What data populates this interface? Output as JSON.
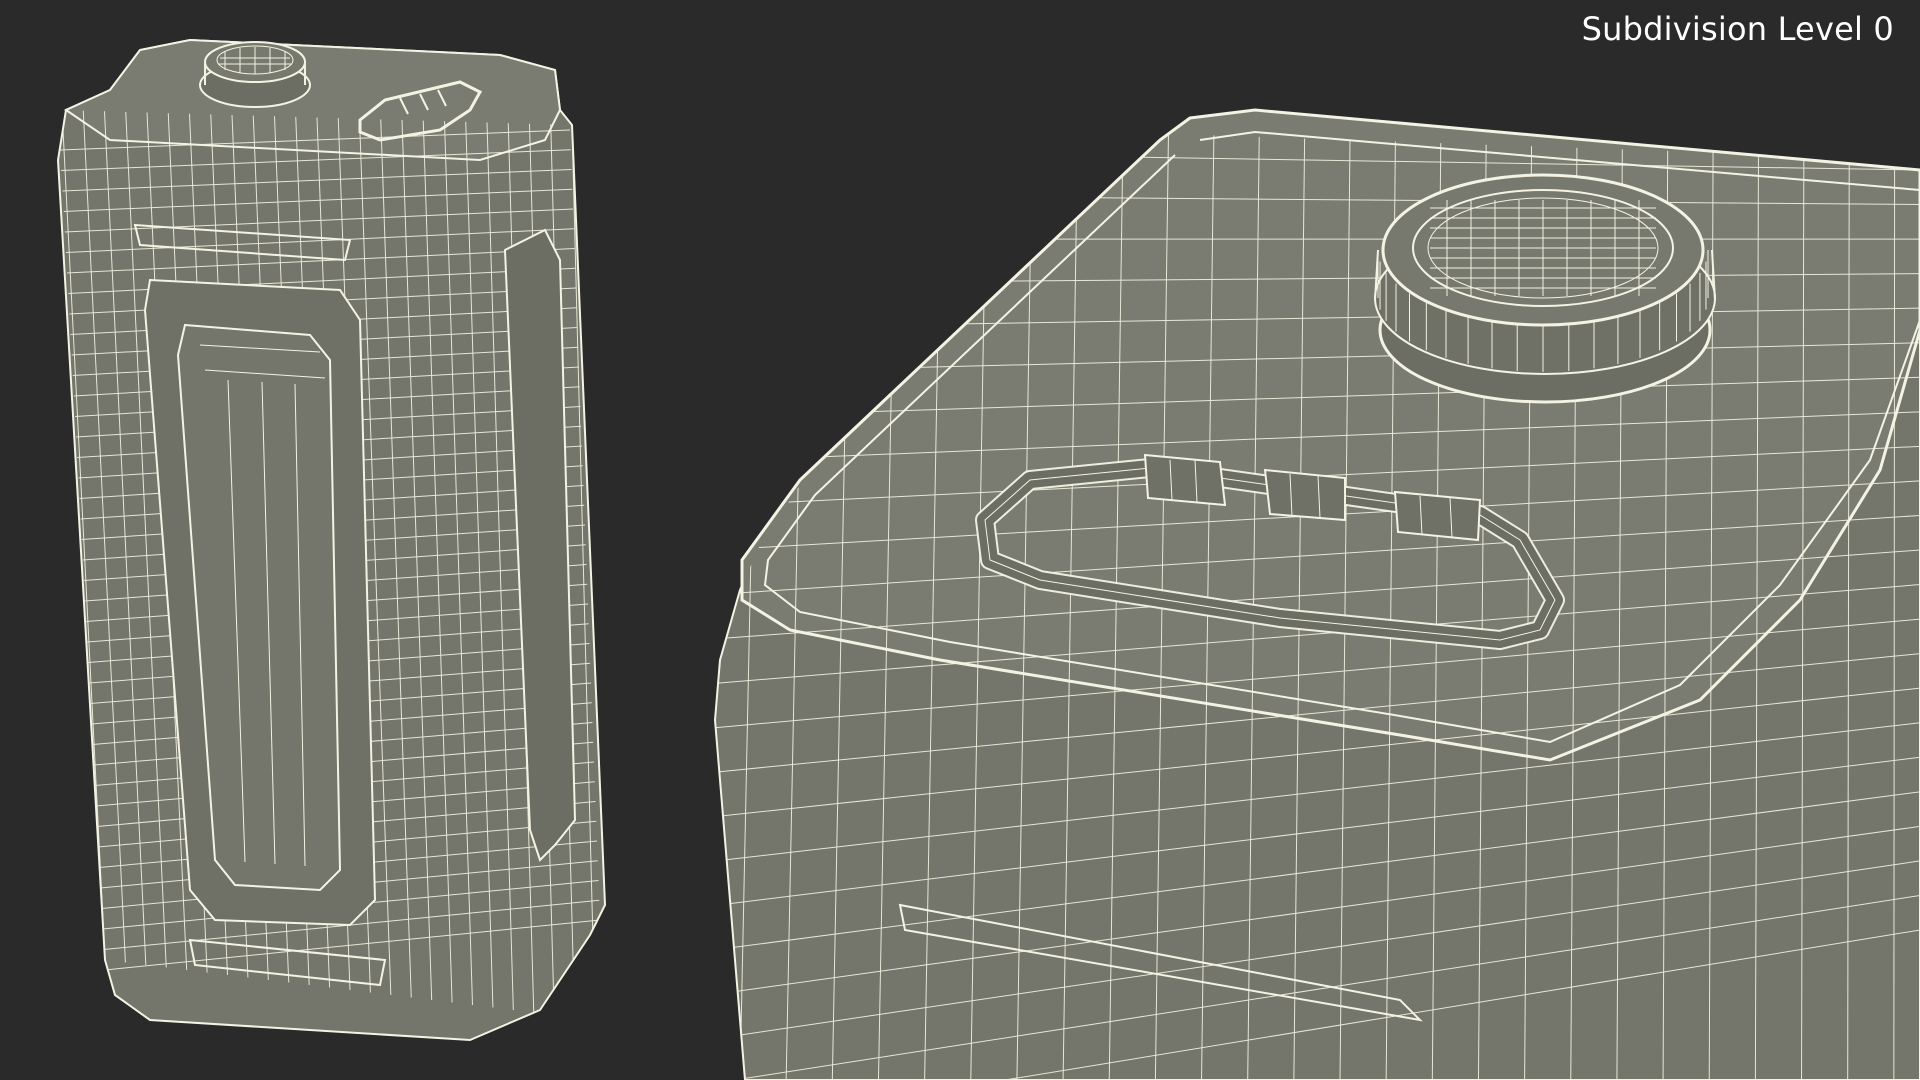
{
  "overlay": {
    "label": "Subdivision Level 0"
  },
  "colors": {
    "background": "#292a29",
    "surface": "#74756b",
    "surface_dark": "#66675e",
    "wire": "#f4f3e3"
  },
  "objects": [
    {
      "name": "jerrycan-full-view"
    },
    {
      "name": "jerrycan-closeup-view"
    }
  ]
}
